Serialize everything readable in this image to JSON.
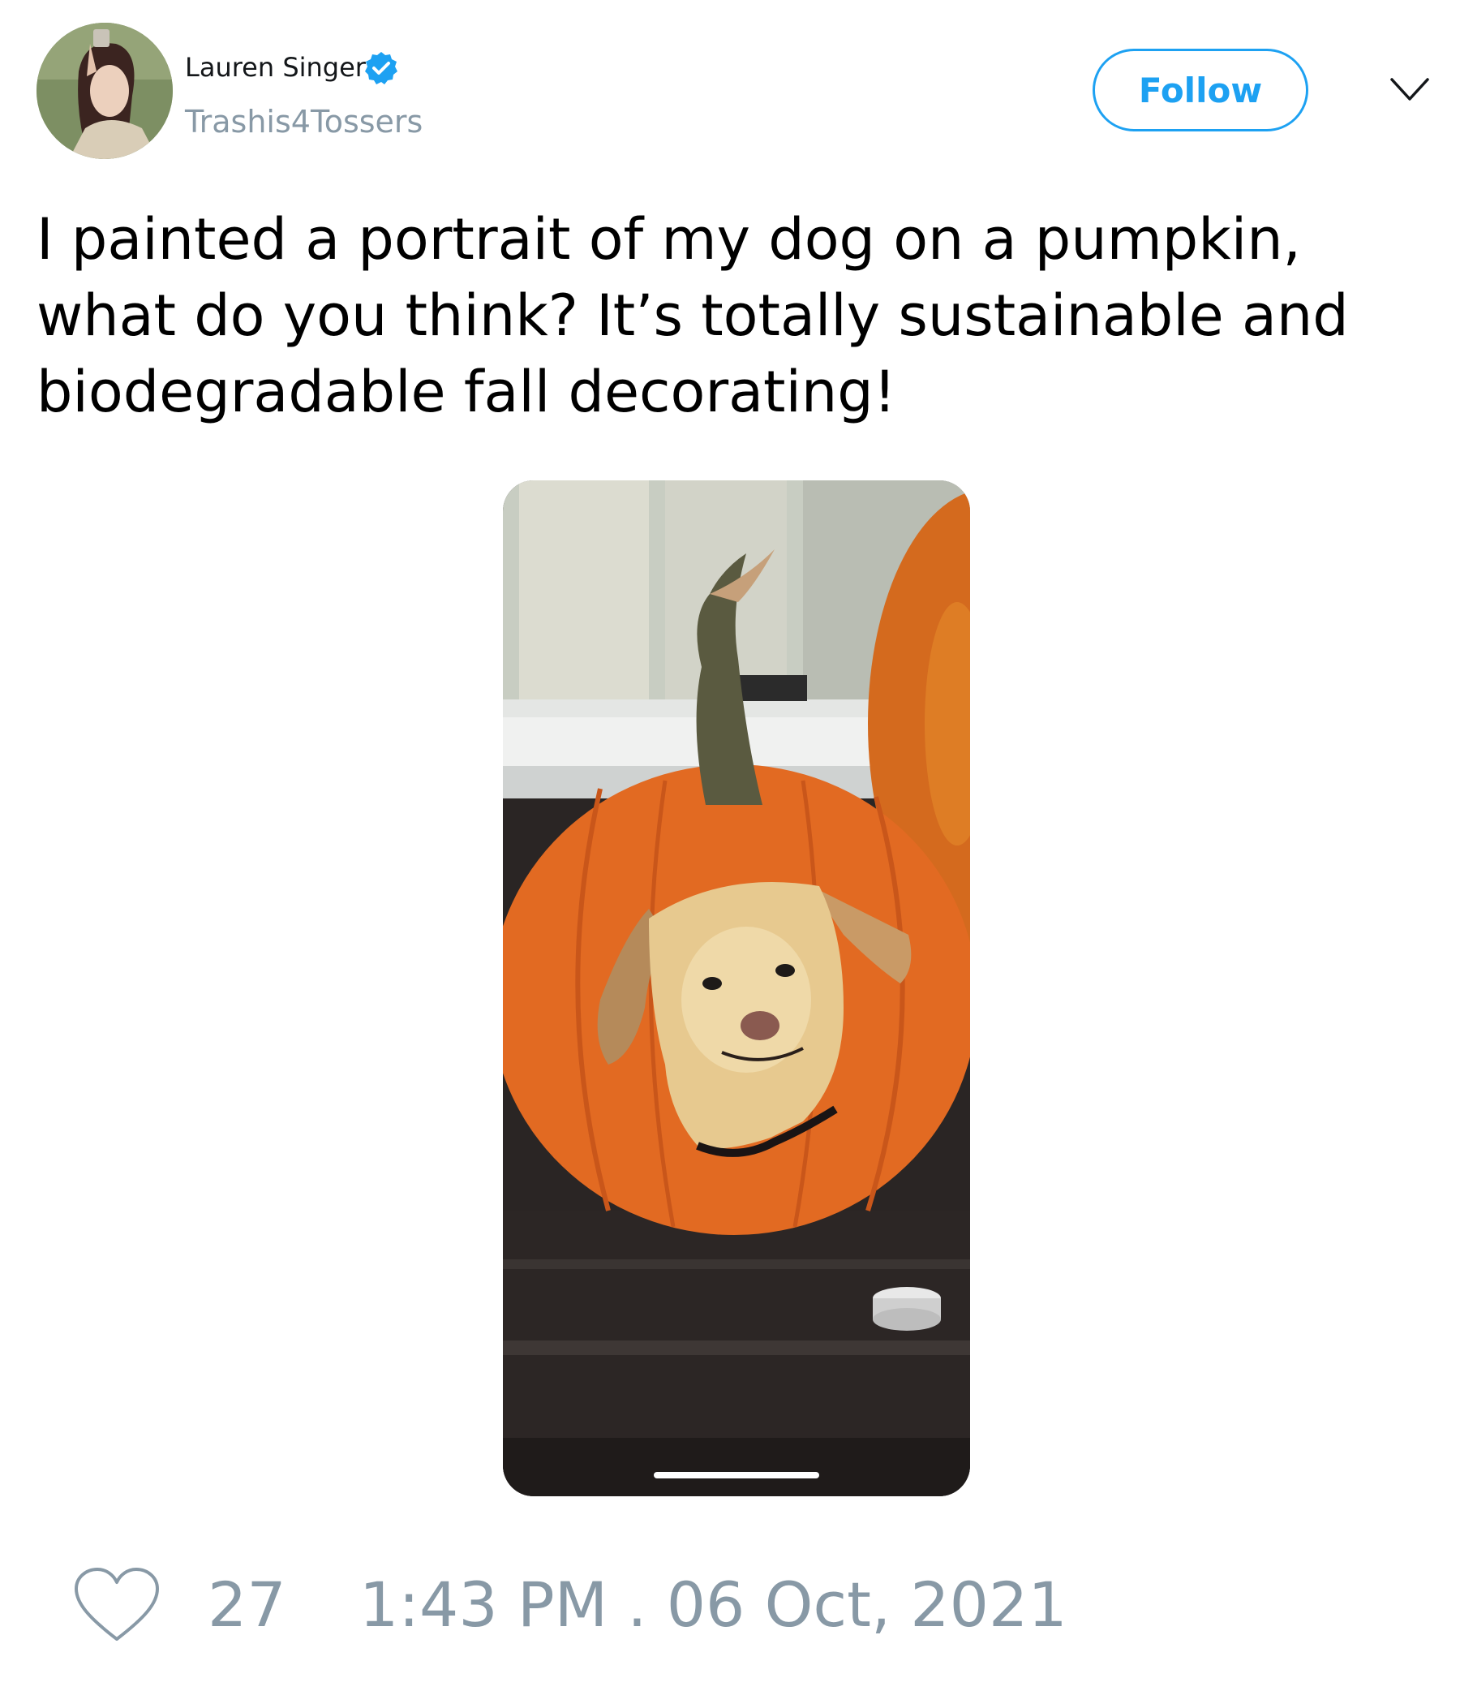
{
  "user": {
    "display_name": "Lauren Singer",
    "handle": "Trashis4Tossers",
    "verified": true,
    "avatar_icon": "profile-photo"
  },
  "follow_label": "Follow",
  "menu_icon": "chevron-down-icon",
  "tweet": {
    "text": "I painted a portrait of my dog on a pumpkin, what do you think? It’s totally sustainable and biodegradable fall decorating!"
  },
  "media": {
    "icon": "pumpkin-dog-portrait-photo"
  },
  "footer": {
    "like_icon": "heart-icon",
    "like_count": "27",
    "timestamp": "1:43 PM . 06 Oct, 2021"
  },
  "colors": {
    "accent": "#1da1f2",
    "muted": "#8899a6",
    "text": "#000000"
  }
}
